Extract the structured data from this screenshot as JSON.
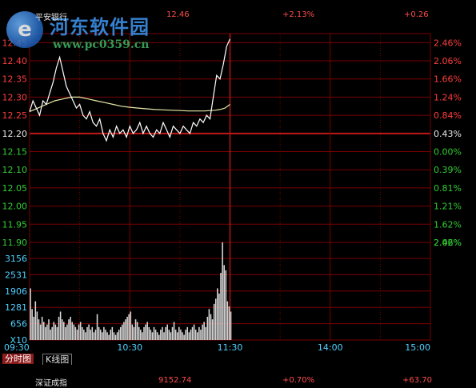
{
  "header": {
    "stock_name": "平安银行",
    "price": "12.46",
    "change_pct": "+2.13%",
    "change": "+0.26"
  },
  "watermark": {
    "title": "河东软件园",
    "url": "www.pc0359.cn"
  },
  "tabs": [
    {
      "label": "分时图",
      "active": true
    },
    {
      "label": "K线图",
      "active": false
    }
  ],
  "status_bar": {
    "index_name": "深证成指",
    "index_value": "9152.74",
    "index_change_pct": "+0.70%",
    "index_change": "+63.70"
  },
  "colors": {
    "up": "#ff3c3c",
    "down": "#33cc33",
    "grid": "#7a0000",
    "price_line": "#ffffff",
    "avg_line": "#e8e8a8",
    "vol_bar": "#d8d8d8",
    "vol_axis": "#4fd0ff"
  },
  "chart_data": {
    "type": "line",
    "x_ticks": [
      "09:30",
      "10:30",
      "11:30",
      "14:00",
      "15:00"
    ],
    "price_axis": {
      "ticks": [
        "12.45",
        "12.40",
        "12.35",
        "12.30",
        "12.25",
        "12.20",
        "12.15",
        "12.10",
        "12.05",
        "12.00",
        "11.95",
        "11.90"
      ],
      "ylim": [
        11.9,
        12.475
      ],
      "prev_close": 12.2
    },
    "pct_axis": {
      "ticks": [
        "2.46%",
        "2.06%",
        "1.66%",
        "1.24%",
        "0.84%",
        "0.43%",
        "0.00%",
        "0.39%",
        "0.81%",
        "1.21%",
        "1.62%",
        "2.02%",
        "2.46%"
      ]
    },
    "volume_axis": {
      "ticks": [
        "3156",
        "2531",
        "1906",
        "1281",
        "656",
        "X10"
      ],
      "ylim": [
        0,
        3780
      ]
    },
    "series": [
      {
        "x": [
          0,
          2,
          4,
          6,
          8,
          10,
          12,
          14,
          16,
          18,
          20,
          22,
          24,
          26,
          28,
          30,
          32,
          34,
          36,
          38,
          40,
          42,
          44,
          46,
          48,
          50,
          52,
          54,
          56,
          58,
          60,
          62,
          64,
          66,
          68,
          70,
          72,
          74,
          76,
          78,
          80,
          82,
          84,
          86,
          88,
          90,
          92,
          94,
          96,
          98,
          100,
          102,
          104,
          106,
          108,
          110,
          112,
          114,
          116,
          118,
          120
        ],
        "y": [
          12.26,
          12.29,
          12.27,
          12.25,
          12.29,
          12.28,
          12.31,
          12.34,
          12.38,
          12.41,
          12.37,
          12.33,
          12.31,
          12.29,
          12.27,
          12.28,
          12.25,
          12.24,
          12.26,
          12.23,
          12.22,
          12.24,
          12.2,
          12.18,
          12.21,
          12.19,
          12.22,
          12.2,
          12.21,
          12.19,
          12.22,
          12.2,
          12.21,
          12.23,
          12.2,
          12.22,
          12.2,
          12.19,
          12.21,
          12.2,
          12.23,
          12.21,
          12.19,
          12.22,
          12.21,
          12.2,
          12.22,
          12.21,
          12.2,
          12.23,
          12.22,
          12.24,
          12.23,
          12.25,
          12.24,
          12.3,
          12.36,
          12.35,
          12.39,
          12.44,
          12.46
        ]
      },
      {
        "x": [
          0,
          5,
          10,
          15,
          20,
          25,
          30,
          35,
          40,
          45,
          50,
          55,
          60,
          65,
          70,
          75,
          80,
          85,
          90,
          95,
          100,
          105,
          108,
          111,
          114,
          117,
          120
        ],
        "y": [
          12.26,
          12.27,
          12.28,
          12.29,
          12.295,
          12.3,
          12.3,
          12.295,
          12.29,
          12.285,
          12.28,
          12.275,
          12.272,
          12.27,
          12.268,
          12.266,
          12.265,
          12.264,
          12.263,
          12.262,
          12.262,
          12.262,
          12.263,
          12.264,
          12.266,
          12.27,
          12.28
        ]
      }
    ],
    "volume": [
      2000,
      1200,
      900,
      1500,
      1100,
      800,
      600,
      900,
      700,
      500,
      600,
      800,
      400,
      500,
      700,
      600,
      500,
      900,
      1100,
      800,
      700,
      500,
      600,
      800,
      900,
      700,
      600,
      500,
      400,
      600,
      700,
      500,
      400,
      300,
      500,
      600,
      400,
      500,
      300,
      400,
      1000,
      500,
      400,
      300,
      500,
      400,
      300,
      200,
      400,
      500,
      300,
      200,
      300,
      400,
      500,
      600,
      700,
      800,
      900,
      1000,
      1100,
      600,
      500,
      800,
      700,
      500,
      400,
      300,
      500,
      600,
      700,
      500,
      400,
      300,
      500,
      400,
      300,
      200,
      400,
      500,
      300,
      500,
      600,
      400,
      300,
      500,
      700,
      400,
      300,
      500,
      400,
      300,
      200,
      400,
      500,
      300,
      400,
      500,
      600,
      400,
      300,
      500,
      400,
      600,
      700,
      500,
      900,
      1200,
      1000,
      800,
      1400,
      1600,
      2000,
      1800,
      2600,
      3780,
      2900,
      2700,
      1500,
      1300,
      1100
    ]
  }
}
